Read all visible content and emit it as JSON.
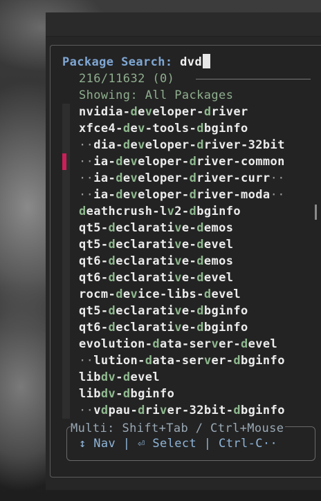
{
  "prompt": {
    "label": "Package Search: ",
    "query": "dvd"
  },
  "status": {
    "counter": "216/11632 (0)",
    "showing": "Showing: All Packages"
  },
  "results": [
    [
      "",
      [
        [
          "n",
          "nvidia-"
        ],
        [
          "m",
          "d"
        ],
        [
          "n",
          "e"
        ],
        [
          "m",
          "v"
        ],
        [
          "n",
          "eloper-"
        ],
        [
          "m",
          "d"
        ],
        [
          "n",
          "river"
        ]
      ]
    ],
    [
      "",
      [
        [
          "n",
          "xfce4-"
        ],
        [
          "m",
          "d"
        ],
        [
          "n",
          "e"
        ],
        [
          "m",
          "v"
        ],
        [
          "n",
          "-tools-"
        ],
        [
          "m",
          "d"
        ],
        [
          "n",
          "bginfo"
        ]
      ]
    ],
    [
      "",
      [
        [
          "e",
          "··"
        ],
        [
          "n",
          "dia-"
        ],
        [
          "m",
          "d"
        ],
        [
          "n",
          "e"
        ],
        [
          "m",
          "v"
        ],
        [
          "n",
          "eloper-"
        ],
        [
          "m",
          "d"
        ],
        [
          "n",
          "river-32bit"
        ]
      ]
    ],
    [
      "",
      [
        [
          "e",
          "··"
        ],
        [
          "n",
          "ia-"
        ],
        [
          "m",
          "d"
        ],
        [
          "n",
          "e"
        ],
        [
          "m",
          "v"
        ],
        [
          "n",
          "eloper-"
        ],
        [
          "m",
          "d"
        ],
        [
          "n",
          "river-common"
        ]
      ]
    ],
    [
      "",
      [
        [
          "e",
          "··"
        ],
        [
          "n",
          "ia-"
        ],
        [
          "m",
          "d"
        ],
        [
          "n",
          "e"
        ],
        [
          "m",
          "v"
        ],
        [
          "n",
          "eloper-"
        ],
        [
          "m",
          "d"
        ],
        [
          "n",
          "river-curr"
        ],
        [
          "e",
          "··"
        ]
      ]
    ],
    [
      "",
      [
        [
          "e",
          "··"
        ],
        [
          "n",
          "ia-"
        ],
        [
          "m",
          "d"
        ],
        [
          "n",
          "e"
        ],
        [
          "m",
          "v"
        ],
        [
          "n",
          "eloper-"
        ],
        [
          "m",
          "d"
        ],
        [
          "n",
          "river-moda"
        ],
        [
          "e",
          "··"
        ]
      ]
    ],
    [
      "",
      [
        [
          "m",
          "d"
        ],
        [
          "n",
          "eathcrush-l"
        ],
        [
          "m",
          "v"
        ],
        [
          "n",
          "2-"
        ],
        [
          "m",
          "d"
        ],
        [
          "n",
          "bginfo"
        ]
      ]
    ],
    [
      "",
      [
        [
          "n",
          "qt5-"
        ],
        [
          "m",
          "d"
        ],
        [
          "n",
          "eclarati"
        ],
        [
          "m",
          "v"
        ],
        [
          "n",
          "e-"
        ],
        [
          "m",
          "d"
        ],
        [
          "n",
          "emos"
        ]
      ]
    ],
    [
      "",
      [
        [
          "n",
          "qt5-"
        ],
        [
          "m",
          "d"
        ],
        [
          "n",
          "eclarati"
        ],
        [
          "m",
          "v"
        ],
        [
          "n",
          "e-"
        ],
        [
          "m",
          "d"
        ],
        [
          "n",
          "evel"
        ]
      ]
    ],
    [
      "",
      [
        [
          "n",
          "qt6-"
        ],
        [
          "m",
          "d"
        ],
        [
          "n",
          "eclarati"
        ],
        [
          "m",
          "v"
        ],
        [
          "n",
          "e-"
        ],
        [
          "m",
          "d"
        ],
        [
          "n",
          "emos"
        ]
      ]
    ],
    [
      "",
      [
        [
          "n",
          "qt6-"
        ],
        [
          "m",
          "d"
        ],
        [
          "n",
          "eclarati"
        ],
        [
          "m",
          "v"
        ],
        [
          "n",
          "e-"
        ],
        [
          "m",
          "d"
        ],
        [
          "n",
          "evel"
        ]
      ]
    ],
    [
      "",
      [
        [
          "n",
          "rocm-"
        ],
        [
          "m",
          "d"
        ],
        [
          "n",
          "e"
        ],
        [
          "m",
          "v"
        ],
        [
          "n",
          "ice-libs-"
        ],
        [
          "m",
          "d"
        ],
        [
          "n",
          "evel"
        ]
      ]
    ],
    [
      "",
      [
        [
          "n",
          "qt5-"
        ],
        [
          "m",
          "d"
        ],
        [
          "n",
          "eclarati"
        ],
        [
          "m",
          "v"
        ],
        [
          "n",
          "e-"
        ],
        [
          "m",
          "d"
        ],
        [
          "n",
          "bginfo"
        ]
      ]
    ],
    [
      "",
      [
        [
          "n",
          "qt6-"
        ],
        [
          "m",
          "d"
        ],
        [
          "n",
          "eclarati"
        ],
        [
          "m",
          "v"
        ],
        [
          "n",
          "e-"
        ],
        [
          "m",
          "d"
        ],
        [
          "n",
          "bginfo"
        ]
      ]
    ],
    [
      "",
      [
        [
          "n",
          "evolution-"
        ],
        [
          "m",
          "d"
        ],
        [
          "n",
          "ata-ser"
        ],
        [
          "m",
          "v"
        ],
        [
          "n",
          "er-"
        ],
        [
          "m",
          "d"
        ],
        [
          "n",
          "evel"
        ]
      ]
    ],
    [
      "",
      [
        [
          "e",
          "··"
        ],
        [
          "n",
          "lution-"
        ],
        [
          "m",
          "d"
        ],
        [
          "n",
          "ata-ser"
        ],
        [
          "m",
          "v"
        ],
        [
          "n",
          "er-"
        ],
        [
          "m",
          "d"
        ],
        [
          "n",
          "bginfo"
        ]
      ]
    ],
    [
      "",
      [
        [
          "n",
          "lib"
        ],
        [
          "m",
          "d"
        ],
        [
          "m",
          "v"
        ],
        [
          "n",
          "-"
        ],
        [
          "m",
          "d"
        ],
        [
          "n",
          "evel"
        ]
      ]
    ],
    [
      "",
      [
        [
          "n",
          "lib"
        ],
        [
          "m",
          "d"
        ],
        [
          "m",
          "v"
        ],
        [
          "n",
          "-"
        ],
        [
          "m",
          "d"
        ],
        [
          "n",
          "bginfo"
        ]
      ]
    ],
    [
      "",
      [
        [
          "e",
          "··"
        ],
        [
          "n",
          "v"
        ],
        [
          "m",
          "d"
        ],
        [
          "n",
          "pau-"
        ],
        [
          "m",
          "d"
        ],
        [
          "n",
          "ri"
        ],
        [
          "m",
          "v"
        ],
        [
          "n",
          "er-32bit-"
        ],
        [
          "m",
          "d"
        ],
        [
          "n",
          "bginfo"
        ]
      ]
    ]
  ],
  "help": {
    "line1": "Multi: Shift+Tab / Ctrl+Mouse",
    "line2": "↕ Nav | ⏎ Select | Ctrl-C··"
  },
  "colors": {
    "accent": "#7fa7d4",
    "match": "#8fb98f",
    "marker": "#cc1f5a"
  }
}
